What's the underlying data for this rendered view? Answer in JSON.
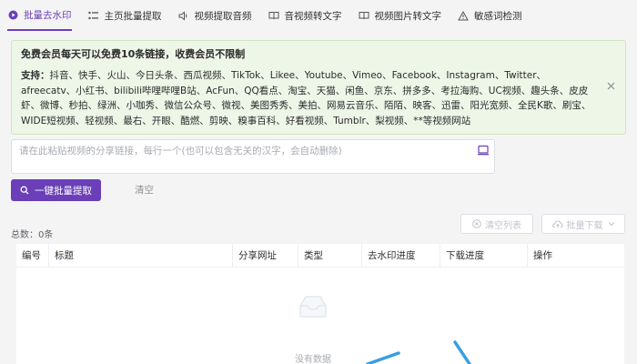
{
  "tabs": [
    {
      "label": "批量去水印",
      "icon": "play-circle-icon"
    },
    {
      "label": "主页批量提取",
      "icon": "dots-icon"
    },
    {
      "label": "视频提取音频",
      "icon": "audio-icon"
    },
    {
      "label": "音视频转文字",
      "icon": "book-icon"
    },
    {
      "label": "视频图片转文字",
      "icon": "book-icon"
    },
    {
      "label": "敏感词检测",
      "icon": "warning-icon"
    }
  ],
  "notice": {
    "title": "免费会员每天可以免费10条链接，收费会员不限制",
    "support_label": "支持：",
    "support_text": "抖音、快手、火山、今日头条、西瓜视频、TikTok、Likee、Youtube、Vimeo、Facebook、Instagram、Twitter、afreecatv、小红书、bilibili哔哩哔哩B站、AcFun、QQ看点、淘宝、天猫、闲鱼、京东、拼多多、考拉海购、UC视频、趣头条、皮皮虾、微博、秒拍、绿洲、小咖秀、微信公众号、微视、美图秀秀、美拍、网易云音乐、陌陌、映客、迅雷、阳光宽频、全民K歌、刷宝、WIDE短视频、轻视频、最右、开眼、酷燃、剪映、糗事百科、好看视频、Tumblr、梨视频、**等视频网站"
  },
  "input": {
    "placeholder": "请在此粘贴视频的分享链接，每行一个(也可以包含无关的汉字，会自动删除)",
    "value": ""
  },
  "actions": {
    "extract_label": "一键批量提取",
    "clear_label": "清空",
    "clear_list_label": "清空列表",
    "batch_download_label": "批量下载"
  },
  "total_label": "总数：0条",
  "table": {
    "columns": [
      "编号",
      "标题",
      "分享网址",
      "类型",
      "去水印进度",
      "下载进度",
      "操作"
    ],
    "empty_text": "没有数据"
  },
  "colors": {
    "accent": "#6a3fb8",
    "notice_bg": "#eef6e8",
    "decoration": "#3a9ee0"
  }
}
